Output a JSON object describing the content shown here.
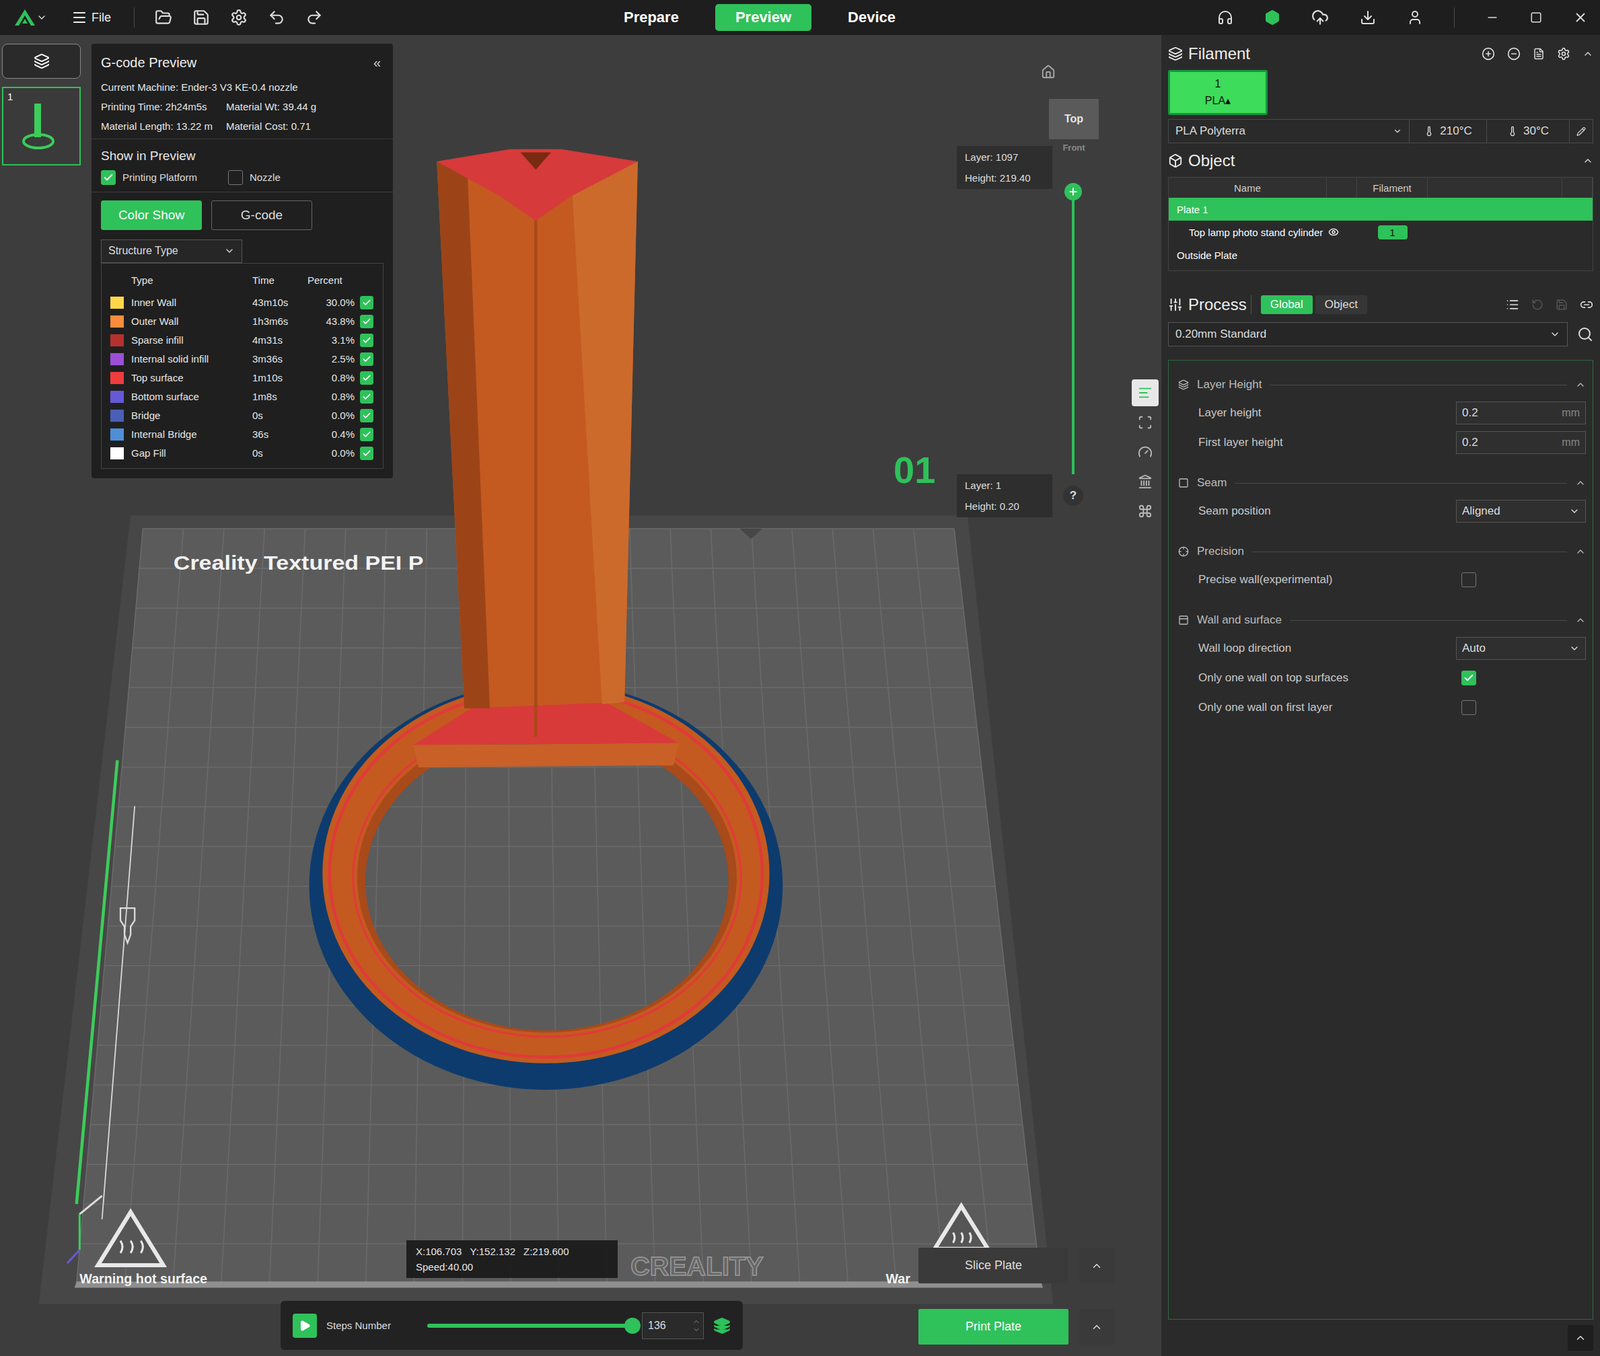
{
  "topbar": {
    "menu": "File",
    "tabs": [
      {
        "label": "Prepare",
        "selected": false
      },
      {
        "label": "Preview",
        "selected": true
      },
      {
        "label": "Device",
        "selected": false
      }
    ]
  },
  "plates": [
    {
      "number": "1",
      "selected": true
    }
  ],
  "gcode_preview": {
    "title": "G-code Preview",
    "collapse": "«",
    "machine": "Current Machine: Ender-3 V3 KE-0.4 nozzle",
    "stats": [
      "Printing Time: 2h24m5s",
      "Material Wt: 39.44 g",
      "Material Length: 13.22 m",
      "Material Cost: 0.71"
    ],
    "show_title": "Show in Preview",
    "show_options": [
      {
        "label": "Printing Platform",
        "checked": true
      },
      {
        "label": "Nozzle",
        "checked": false
      }
    ],
    "modes": [
      {
        "label": "Color Show",
        "selected": true
      },
      {
        "label": "G-code",
        "selected": false
      }
    ],
    "view_type": "Structure Type",
    "legend": {
      "columns": [
        "Type",
        "Time",
        "Percent"
      ],
      "rows": [
        {
          "type": "Inner Wall",
          "time": "43m10s",
          "percent": "30.0%",
          "color": "#ffd84a",
          "visible": true
        },
        {
          "type": "Outer Wall",
          "time": "1h3m6s",
          "percent": "43.8%",
          "color": "#ff8c3a",
          "visible": true
        },
        {
          "type": "Sparse infill",
          "time": "4m31s",
          "percent": "3.1%",
          "color": "#b5302e",
          "visible": true
        },
        {
          "type": "Internal solid infill",
          "time": "3m36s",
          "percent": "2.5%",
          "color": "#9b4fd6",
          "visible": true
        },
        {
          "type": "Top surface",
          "time": "1m10s",
          "percent": "0.8%",
          "color": "#f03c3c",
          "visible": true
        },
        {
          "type": "Bottom surface",
          "time": "1m8s",
          "percent": "0.8%",
          "color": "#6659d6",
          "visible": true
        },
        {
          "type": "Bridge",
          "time": "0s",
          "percent": "0.0%",
          "color": "#4a5fb8",
          "visible": true
        },
        {
          "type": "Internal Bridge",
          "time": "36s",
          "percent": "0.4%",
          "color": "#4f8fd8",
          "visible": true
        },
        {
          "type": "Gap Fill",
          "time": "0s",
          "percent": "0.0%",
          "color": "#ffffff",
          "visible": true
        }
      ]
    }
  },
  "canvas": {
    "bed_label": "Creality Textured PEI P",
    "brand": "CREALITY",
    "warnings": [
      "Warning hot surface",
      "War"
    ],
    "plate_number": "01"
  },
  "view_cube": {
    "top": "Top",
    "front": "Front"
  },
  "layer_slider": {
    "upper": {
      "layer": "Layer: 1097",
      "height": "Height: 219.40",
      "level": 1
    },
    "lower": {
      "layer": "Layer: 1",
      "height": "Height: 0.20",
      "level": 0
    },
    "help": "?"
  },
  "position": {
    "x": "X:106.703",
    "y": "Y:152.132",
    "z": "Z:219.600",
    "speed": "Speed:40.00"
  },
  "steps": {
    "label": "Steps Number",
    "level": 1,
    "value": "136"
  },
  "actions": [
    {
      "label": "Slice Plate",
      "primary": false
    },
    {
      "label": "Print Plate",
      "primary": true
    }
  ],
  "view_tabs": [
    {
      "selected": true
    },
    {
      "selected": false
    },
    {
      "selected": false
    },
    {
      "selected": false
    },
    {
      "selected": false
    }
  ],
  "filament": {
    "title": "Filament",
    "slots": [
      {
        "number": "1",
        "type": "PLA",
        "arrow": "▴",
        "selected": true,
        "color": "#3ddc5a"
      }
    ],
    "preset": "PLA Polyterra",
    "nozzle_temp": "210°C",
    "bed_temp": "30°C"
  },
  "object": {
    "title": "Object",
    "columns": [
      "Name",
      "Filament"
    ],
    "rows": [
      {
        "name": "Plate 1",
        "kind": "plate",
        "selected": true,
        "filament": ""
      },
      {
        "name": "Top lamp photo stand cylinder",
        "kind": "object",
        "selected": false,
        "visible": true,
        "filament": "1"
      },
      {
        "name": "Outside Plate",
        "kind": "plate",
        "selected": false,
        "filament": ""
      }
    ]
  },
  "process": {
    "title": "Process",
    "tabs": [
      {
        "label": "Global",
        "selected": true
      },
      {
        "label": "Object",
        "selected": false
      }
    ],
    "preset": "0.20mm Standard",
    "groups": [
      {
        "title": "Layer Height",
        "expanded": true,
        "items": [
          {
            "label": "Layer height",
            "kind": "number",
            "value": "0.2",
            "unit": "mm"
          },
          {
            "label": "First layer height",
            "kind": "number",
            "value": "0.2",
            "unit": "mm"
          }
        ]
      },
      {
        "title": "Seam",
        "expanded": true,
        "items": [
          {
            "label": "Seam position",
            "kind": "select",
            "value": "Aligned"
          }
        ]
      },
      {
        "title": "Precision",
        "expanded": true,
        "items": [
          {
            "label": "Precise wall(experimental)",
            "kind": "checkbox",
            "checked": false
          }
        ]
      },
      {
        "title": "Wall and surface",
        "expanded": true,
        "items": [
          {
            "label": "Wall loop direction",
            "kind": "select",
            "value": "Auto"
          },
          {
            "label": "Only one wall on top surfaces",
            "kind": "checkbox",
            "checked": true
          },
          {
            "label": "Only one wall on first layer",
            "kind": "checkbox",
            "checked": false
          }
        ]
      }
    ]
  }
}
